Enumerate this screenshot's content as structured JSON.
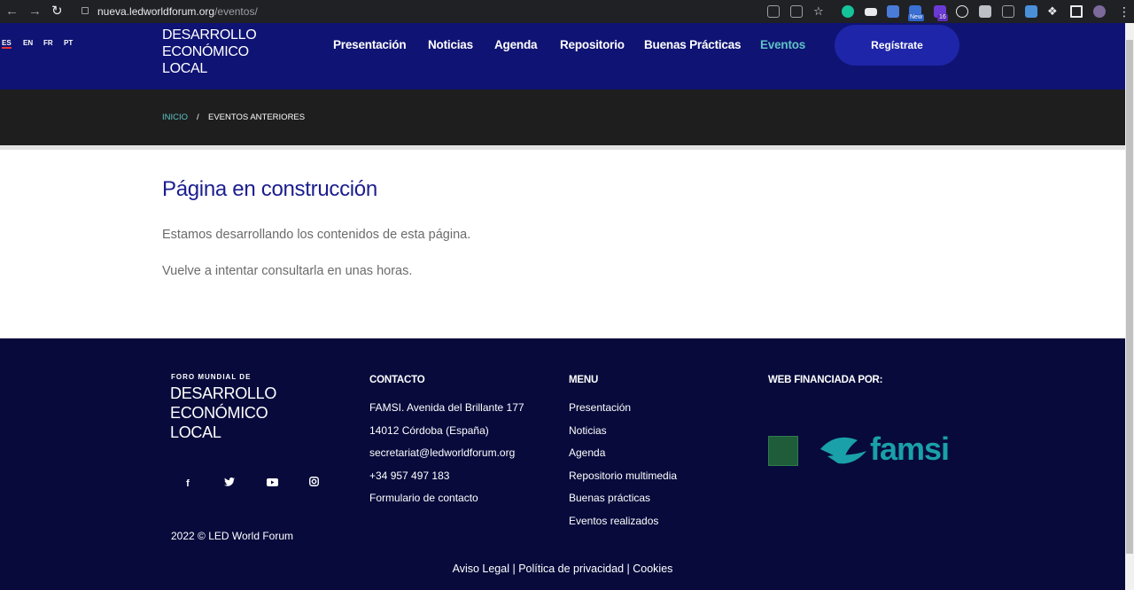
{
  "browser": {
    "url_host": "nueva.ledworldforum.org",
    "url_path": "/eventos/",
    "ext_new_badge": "New",
    "ext_count_badge": "16"
  },
  "header": {
    "languages": [
      "ES",
      "EN",
      "FR",
      "PT"
    ],
    "logo_lines": [
      "DESARROLLO",
      "ECONÓMICO",
      "LOCAL"
    ],
    "menu": [
      "Presentación",
      "Noticias",
      "Agenda",
      "Repositorio",
      "Buenas Prácticas",
      "Eventos"
    ],
    "register_label": "Regístrate"
  },
  "breadcrumb": {
    "home": "INICIO",
    "separator": "/",
    "current": "EVENTOS ANTERIORES"
  },
  "main": {
    "title": "Página en construcción",
    "paragraphs": [
      "Estamos desarrollando los contenidos de esta página.",
      "Vuelve a intentar consultarla en unas horas."
    ]
  },
  "footer": {
    "logo_small": "FORO MUNDIAL DE",
    "logo_lines": [
      "DESARROLLO",
      "ECONÓMICO",
      "LOCAL"
    ],
    "social_icons": [
      "facebook-icon",
      "twitter-icon",
      "youtube-icon",
      "instagram-icon"
    ],
    "contact": {
      "heading": "CONTACTO",
      "items": [
        "FAMSI. Avenida del Brillante 177",
        "14012 Córdoba (España)",
        "secretariat@ledworldforum.org",
        "+34 957 497 183",
        "Formulario de contacto"
      ]
    },
    "menu": {
      "heading": "MENU",
      "items": [
        "Presentación",
        "Noticias",
        "Agenda",
        "Repositorio multimedia",
        "Buenas prácticas",
        "Eventos realizados"
      ]
    },
    "funded": {
      "heading": "WEB FINANCIADA POR:",
      "famsi_text": "famsi"
    },
    "copyright": "2022 © LED World Forum",
    "legal": [
      "Aviso Legal",
      "Política de privacidad",
      "Cookies"
    ],
    "legal_separator": "|"
  },
  "colors": {
    "header_bg": "#0f1373",
    "accent": "#5ec2c4",
    "footer_bg": "#070a3b",
    "title": "#1b1e8f"
  }
}
